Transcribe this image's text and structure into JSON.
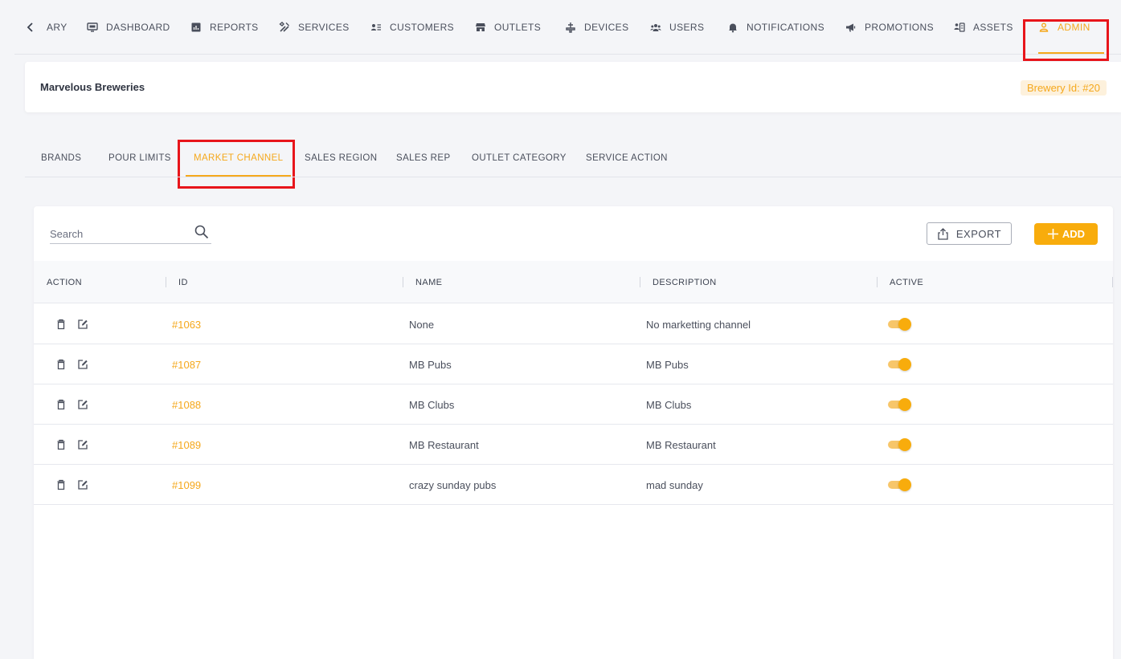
{
  "nav": {
    "items": [
      {
        "label": "ARY",
        "icon": "history-icon"
      },
      {
        "label": "DASHBOARD",
        "icon": "monitor-icon"
      },
      {
        "label": "REPORTS",
        "icon": "report-chart-icon"
      },
      {
        "label": "SERVICES",
        "icon": "tools-icon"
      },
      {
        "label": "CUSTOMERS",
        "icon": "customer-card-icon"
      },
      {
        "label": "OUTLETS",
        "icon": "store-icon"
      },
      {
        "label": "DEVICES",
        "icon": "tap-device-icon"
      },
      {
        "label": "USERS",
        "icon": "users-group-icon"
      },
      {
        "label": "NOTIFICATIONS",
        "icon": "bell-icon"
      },
      {
        "label": "PROMOTIONS",
        "icon": "megaphone-icon"
      },
      {
        "label": "ASSETS",
        "icon": "assets-icon"
      },
      {
        "label": "ADMIN",
        "icon": "person-icon"
      }
    ],
    "active": "ADMIN"
  },
  "header": {
    "brewery_name": "Marvelous Breweries",
    "brewery_id": "Brewery Id: #20"
  },
  "subtabs": {
    "items": [
      "BRANDS",
      "POUR LIMITS",
      "MARKET CHANNEL",
      "SALES REGION",
      "SALES REP",
      "OUTLET CATEGORY",
      "SERVICE ACTION"
    ],
    "active": "MARKET CHANNEL"
  },
  "toolbar": {
    "search_placeholder": "Search",
    "export_label": "EXPORT",
    "add_label": "ADD"
  },
  "table": {
    "columns": [
      "ACTION",
      "ID",
      "NAME",
      "DESCRIPTION",
      "ACTIVE"
    ],
    "rows": [
      {
        "id": "#1063",
        "name": "None",
        "description": "No marketting channel",
        "active": true
      },
      {
        "id": "#1087",
        "name": "MB Pubs",
        "description": "MB Pubs",
        "active": true
      },
      {
        "id": "#1088",
        "name": "MB Clubs",
        "description": "MB Clubs",
        "active": true
      },
      {
        "id": "#1089",
        "name": "MB Restaurant",
        "description": "MB Restaurant",
        "active": true
      },
      {
        "id": "#1099",
        "name": "crazy sunday pubs",
        "description": "mad sunday",
        "active": true
      }
    ]
  },
  "colors": {
    "accent": "#f5a81c",
    "add_button": "#f8ac0c",
    "highlight_box": "#e8151b"
  }
}
